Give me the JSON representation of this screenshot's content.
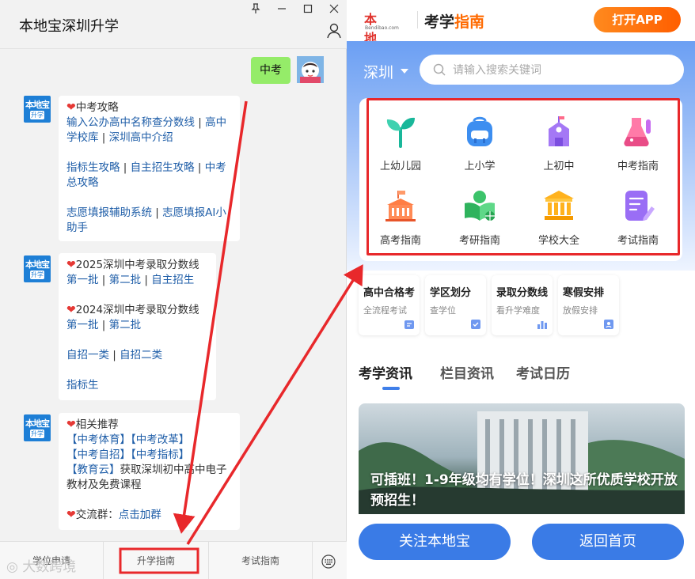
{
  "chat": {
    "title": "本地宝深圳升学",
    "my_message": "中考",
    "cards": [
      {
        "lines": [
          [
            {
              "t": "❤",
              "k": "heart"
            },
            {
              "t": "中考攻略",
              "k": "text"
            }
          ],
          [
            {
              "t": "输入公办高中名称查分数线",
              "k": "link"
            },
            {
              "t": " | ",
              "k": "sep"
            },
            {
              "t": "高中",
              "k": "link"
            }
          ],
          [
            {
              "t": "学校库",
              "k": "link"
            },
            {
              "t": " | ",
              "k": "sep"
            },
            {
              "t": "深圳高中介绍",
              "k": "link"
            }
          ],
          [],
          [
            {
              "t": "指标生攻略",
              "k": "link"
            },
            {
              "t": " | ",
              "k": "sep"
            },
            {
              "t": "自主招生攻略",
              "k": "link"
            },
            {
              "t": " | ",
              "k": "sep"
            },
            {
              "t": "中考",
              "k": "link"
            }
          ],
          [
            {
              "t": "总攻略",
              "k": "link"
            }
          ],
          [],
          [
            {
              "t": "志愿填报辅助系统",
              "k": "link"
            },
            {
              "t": " | ",
              "k": "sep"
            },
            {
              "t": "志愿填报AI小",
              "k": "link"
            }
          ],
          [
            {
              "t": "助手",
              "k": "link"
            }
          ]
        ]
      },
      {
        "lines": [
          [
            {
              "t": "❤",
              "k": "heart"
            },
            {
              "t": "2025深圳中考录取分数线",
              "k": "text"
            }
          ],
          [
            {
              "t": "第一批",
              "k": "link"
            },
            {
              "t": " | ",
              "k": "sep"
            },
            {
              "t": "第二批",
              "k": "link"
            },
            {
              "t": " | ",
              "k": "sep"
            },
            {
              "t": "自主招生",
              "k": "link"
            }
          ],
          [],
          [
            {
              "t": "❤",
              "k": "heart"
            },
            {
              "t": "2024深圳中考录取分数线",
              "k": "text"
            }
          ],
          [
            {
              "t": "第一批",
              "k": "link"
            },
            {
              "t": " | ",
              "k": "sep"
            },
            {
              "t": "第二批",
              "k": "link"
            }
          ],
          [],
          [
            {
              "t": "自招一类",
              "k": "link"
            },
            {
              "t": " | ",
              "k": "sep"
            },
            {
              "t": "自招二类",
              "k": "link"
            }
          ],
          [],
          [
            {
              "t": "指标生",
              "k": "link"
            }
          ]
        ]
      },
      {
        "lines": [
          [
            {
              "t": "❤",
              "k": "heart"
            },
            {
              "t": "相关推荐",
              "k": "text"
            }
          ],
          [
            {
              "t": "【中考体育】",
              "k": "link"
            },
            {
              "t": "【中考改革】",
              "k": "link"
            }
          ],
          [
            {
              "t": "【中考自招】",
              "k": "link"
            },
            {
              "t": "【中考指标】",
              "k": "link"
            }
          ],
          [
            {
              "t": "【教育云】",
              "k": "link"
            },
            {
              "t": "获取深圳初中高中电子",
              "k": "text"
            }
          ],
          [
            {
              "t": "教材及免费课程",
              "k": "text"
            }
          ],
          [],
          [
            {
              "t": "❤",
              "k": "heart"
            },
            {
              "t": "交流群：",
              "k": "text"
            },
            {
              "t": "点击加群",
              "k": "link"
            }
          ]
        ]
      }
    ],
    "bottom_tabs": [
      "学位申请",
      "升学指南",
      "考试指南"
    ],
    "watermark": "大数跨境"
  },
  "app": {
    "logo_cn": "本地宝",
    "logo_en": "Bendibao.com",
    "brand_a": "考学",
    "brand_b": "指南",
    "open_app": "打开APP",
    "city": "深圳",
    "search_placeholder": "请输入搜索关键词",
    "categories": [
      {
        "label": "上幼儿园",
        "icon": "sprout-icon"
      },
      {
        "label": "上小学",
        "icon": "schoolbag-icon"
      },
      {
        "label": "上初中",
        "icon": "school-building-icon"
      },
      {
        "label": "中考指南",
        "icon": "flask-icon"
      },
      {
        "label": "高考指南",
        "icon": "campus-icon"
      },
      {
        "label": "考研指南",
        "icon": "globe-book-icon"
      },
      {
        "label": "学校大全",
        "icon": "institution-icon"
      },
      {
        "label": "考试指南",
        "icon": "exam-paper-icon"
      }
    ],
    "quick_cards": [
      {
        "title": "高中合格考",
        "sub": "全流程考试"
      },
      {
        "title": "学区划分",
        "sub": "查学位"
      },
      {
        "title": "录取分数线",
        "sub": "看升学难度"
      },
      {
        "title": "寒假安排",
        "sub": "放假安排"
      }
    ],
    "news_tabs": [
      "考学资讯",
      "栏目资讯",
      "考试日历"
    ],
    "news_title": "可插班！1-9年级均有学位！深圳这所优质学校开放预招生！",
    "btn_follow": "关注本地宝",
    "btn_home": "返回首页",
    "colors": {
      "accent": "#3a7be6",
      "brand_orange": "#ff6a00",
      "highlight_red": "#e8282b"
    }
  }
}
